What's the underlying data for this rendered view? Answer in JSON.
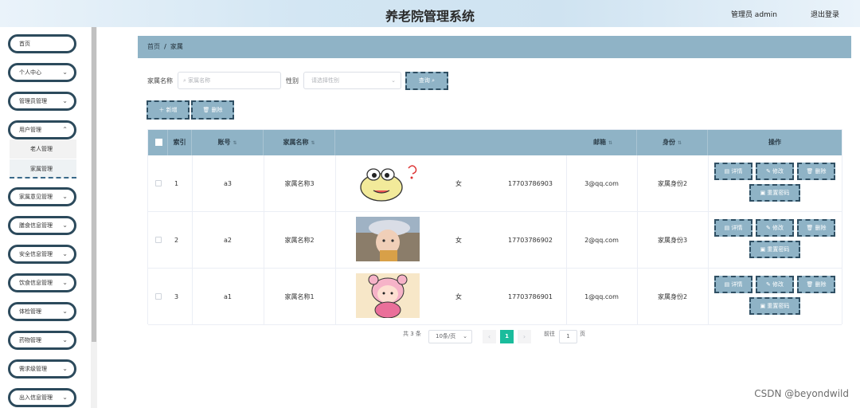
{
  "header": {
    "title": "养老院管理系统",
    "user": "管理员 admin",
    "logout": "退出登录"
  },
  "sidebar": {
    "items": [
      {
        "label": "首页",
        "chevron": false
      },
      {
        "label": "个人中心",
        "chevron": true
      },
      {
        "label": "管理员管理",
        "chevron": true
      },
      {
        "label": "用户管理",
        "chevron": true
      },
      {
        "label": "家属意见管理",
        "chevron": true
      },
      {
        "label": "膳食信息管理",
        "chevron": true
      },
      {
        "label": "安全信息管理",
        "chevron": true
      },
      {
        "label": "饮食信息管理",
        "chevron": true
      },
      {
        "label": "体检管理",
        "chevron": true
      },
      {
        "label": "药物管理",
        "chevron": true
      },
      {
        "label": "需求级管理",
        "chevron": true
      },
      {
        "label": "出入信息管理",
        "chevron": true
      }
    ],
    "subitems": [
      {
        "label": "老人管理"
      },
      {
        "label": "家属管理"
      }
    ]
  },
  "breadcrumb": {
    "home": "首页",
    "sep": "/",
    "current": "家属"
  },
  "search": {
    "name_label": "家属名称",
    "name_placeholder": "家属名称",
    "gender_label": "性别",
    "gender_placeholder": "请选择性别",
    "query_button": "查询"
  },
  "actions": {
    "add": "新增",
    "delete": "删除"
  },
  "table": {
    "headers": {
      "index": "索引",
      "account": "账号",
      "name": "家属名称",
      "email": "邮箱",
      "identity": "身份",
      "ops": "操作"
    },
    "rows": [
      {
        "index": "1",
        "account": "a3",
        "name": "家属名称3",
        "gender": "女",
        "phone": "17703786903",
        "email": "3@qq.com",
        "identity": "家属身份2"
      },
      {
        "index": "2",
        "account": "a2",
        "name": "家属名称2",
        "gender": "女",
        "phone": "17703786902",
        "email": "2@qq.com",
        "identity": "家属身份3"
      },
      {
        "index": "3",
        "account": "a1",
        "name": "家属名称1",
        "gender": "女",
        "phone": "17703786901",
        "email": "1@qq.com",
        "identity": "家属身份2"
      }
    ],
    "ops": {
      "detail": "详情",
      "edit": "修改",
      "delete": "删除",
      "reset": "重置密码"
    }
  },
  "pagination": {
    "total": "共 3 条",
    "page_size": "10条/页",
    "current_page": "1",
    "goto_label": "前往",
    "goto_value": "1",
    "page_unit": "页"
  },
  "watermark": "CSDN @beyondwild",
  "colors": {
    "accent": "#8fb3c6",
    "border_dark": "#2f4f63",
    "pager_active": "#1abc9c"
  }
}
